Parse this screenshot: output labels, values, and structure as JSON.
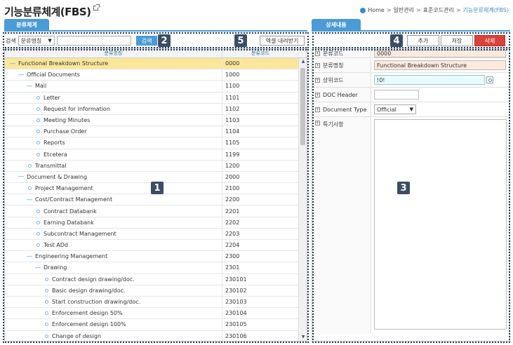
{
  "page": {
    "title": "기능분류체계(FBS)"
  },
  "breadcrumb": {
    "items": [
      "Home",
      "일반관리",
      "표준코드관리",
      "기능분류체계(FBS)"
    ],
    "separator": ">"
  },
  "tabs": {
    "left": "분류체계",
    "right": "상세내용"
  },
  "search": {
    "label": "검색",
    "field_select": "분류명칭",
    "query_value": "",
    "button": "검색",
    "export_button": "엑셀 내려받기"
  },
  "tree": {
    "header_name": "분류명칭",
    "header_code": "분류코드",
    "rows": [
      {
        "name": "Functional Breakdown Structure",
        "code": "0000",
        "level": 0,
        "type": "branch",
        "selected": true
      },
      {
        "name": "Official Documents",
        "code": "1000",
        "level": 1,
        "type": "branch"
      },
      {
        "name": "Mail",
        "code": "1100",
        "level": 2,
        "type": "branch"
      },
      {
        "name": "Letter",
        "code": "1101",
        "level": 3,
        "type": "leaf"
      },
      {
        "name": "Request for Information",
        "code": "1102",
        "level": 3,
        "type": "leaf"
      },
      {
        "name": "Meeting Minutes",
        "code": "1103",
        "level": 3,
        "type": "leaf"
      },
      {
        "name": "Purchase Order",
        "code": "1104",
        "level": 3,
        "type": "leaf"
      },
      {
        "name": "Reports",
        "code": "1105",
        "level": 3,
        "type": "leaf"
      },
      {
        "name": "Etcetera",
        "code": "1199",
        "level": 3,
        "type": "leaf"
      },
      {
        "name": "Transmittal",
        "code": "1200",
        "level": 2,
        "type": "leaf"
      },
      {
        "name": "Document & Drawing",
        "code": "2000",
        "level": 1,
        "type": "branch"
      },
      {
        "name": "Project Management",
        "code": "2100",
        "level": 2,
        "type": "leaf"
      },
      {
        "name": "Cost/Contract Management",
        "code": "2200",
        "level": 2,
        "type": "branch"
      },
      {
        "name": "Contract Databank",
        "code": "2201",
        "level": 3,
        "type": "leaf"
      },
      {
        "name": "Earning Databank",
        "code": "2202",
        "level": 3,
        "type": "leaf"
      },
      {
        "name": "Subcontract Management",
        "code": "2203",
        "level": 3,
        "type": "leaf"
      },
      {
        "name": "Test ADd",
        "code": "2204",
        "level": 3,
        "type": "leaf"
      },
      {
        "name": "Engineering Management",
        "code": "2300",
        "level": 2,
        "type": "branch"
      },
      {
        "name": "Drawing",
        "code": "2301",
        "level": 3,
        "type": "branch"
      },
      {
        "name": "Contract design drawing/doc.",
        "code": "230101",
        "level": 4,
        "type": "leaf"
      },
      {
        "name": "Basic design drawing/doc.",
        "code": "230102",
        "level": 4,
        "type": "leaf"
      },
      {
        "name": "Start construction drawing/doc.",
        "code": "230103",
        "level": 4,
        "type": "leaf"
      },
      {
        "name": "Enforcement design 50%",
        "code": "230104",
        "level": 4,
        "type": "leaf"
      },
      {
        "name": "Enforcement design 100%",
        "code": "230105",
        "level": 4,
        "type": "leaf"
      },
      {
        "name": "Change of design",
        "code": "230106",
        "level": 4,
        "type": "leaf"
      }
    ]
  },
  "detail_toolbar": {
    "add": "추가",
    "save": "저장",
    "delete": "삭제"
  },
  "detail": {
    "code_label": "분류코드",
    "code_value": "0000",
    "name_label": "분류명칭",
    "name_value": "Functional Breakdown Structure",
    "parent_label": "상위코드",
    "parent_value": "!0!",
    "doc_header_label": "DOC Header",
    "doc_header_value": "",
    "doc_type_label": "Document Type",
    "doc_type_value": "Official",
    "remarks_label": "특기사항",
    "remarks_value": ""
  },
  "annotations": {
    "badge1": "1",
    "badge2": "2",
    "badge3": "3",
    "badge4": "4",
    "badge5": "5"
  },
  "colors": {
    "tab_blue": "#4a9bd6",
    "selected_row": "#fbe79a",
    "delete_red": "#d9423a",
    "badge_bg": "#3c4d66"
  }
}
